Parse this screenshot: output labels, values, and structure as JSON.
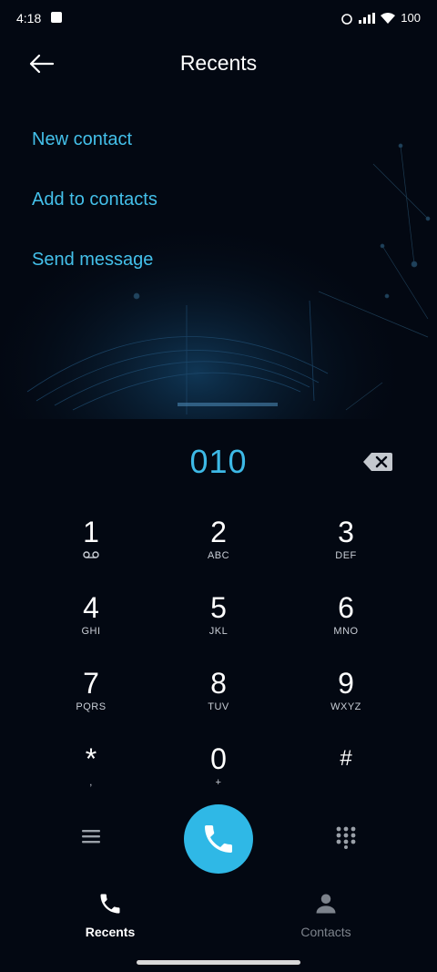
{
  "status_bar": {
    "time": "4:18",
    "battery": "100"
  },
  "header": {
    "title": "Recents"
  },
  "menu": {
    "new_contact": "New contact",
    "add_to_contacts": "Add to contacts",
    "send_message": "Send message"
  },
  "dialer": {
    "number": "010"
  },
  "keypad": {
    "keys": [
      {
        "digit": "1",
        "letters": ""
      },
      {
        "digit": "2",
        "letters": "ABC"
      },
      {
        "digit": "3",
        "letters": "DEF"
      },
      {
        "digit": "4",
        "letters": "GHI"
      },
      {
        "digit": "5",
        "letters": "JKL"
      },
      {
        "digit": "6",
        "letters": "MNO"
      },
      {
        "digit": "7",
        "letters": "PQRS"
      },
      {
        "digit": "8",
        "letters": "TUV"
      },
      {
        "digit": "9",
        "letters": "WXYZ"
      },
      {
        "digit": "*",
        "letters": ","
      },
      {
        "digit": "0",
        "letters": "+"
      },
      {
        "digit": "#",
        "letters": ""
      }
    ]
  },
  "nav": {
    "recents": "Recents",
    "contacts": "Contacts"
  },
  "colors": {
    "accent": "#3db9e6",
    "background": "#030812"
  },
  "icons": [
    "back-arrow-icon",
    "backspace-icon",
    "voicemail-icon",
    "menu-icon",
    "phone-icon",
    "dialpad-icon",
    "person-icon"
  ]
}
